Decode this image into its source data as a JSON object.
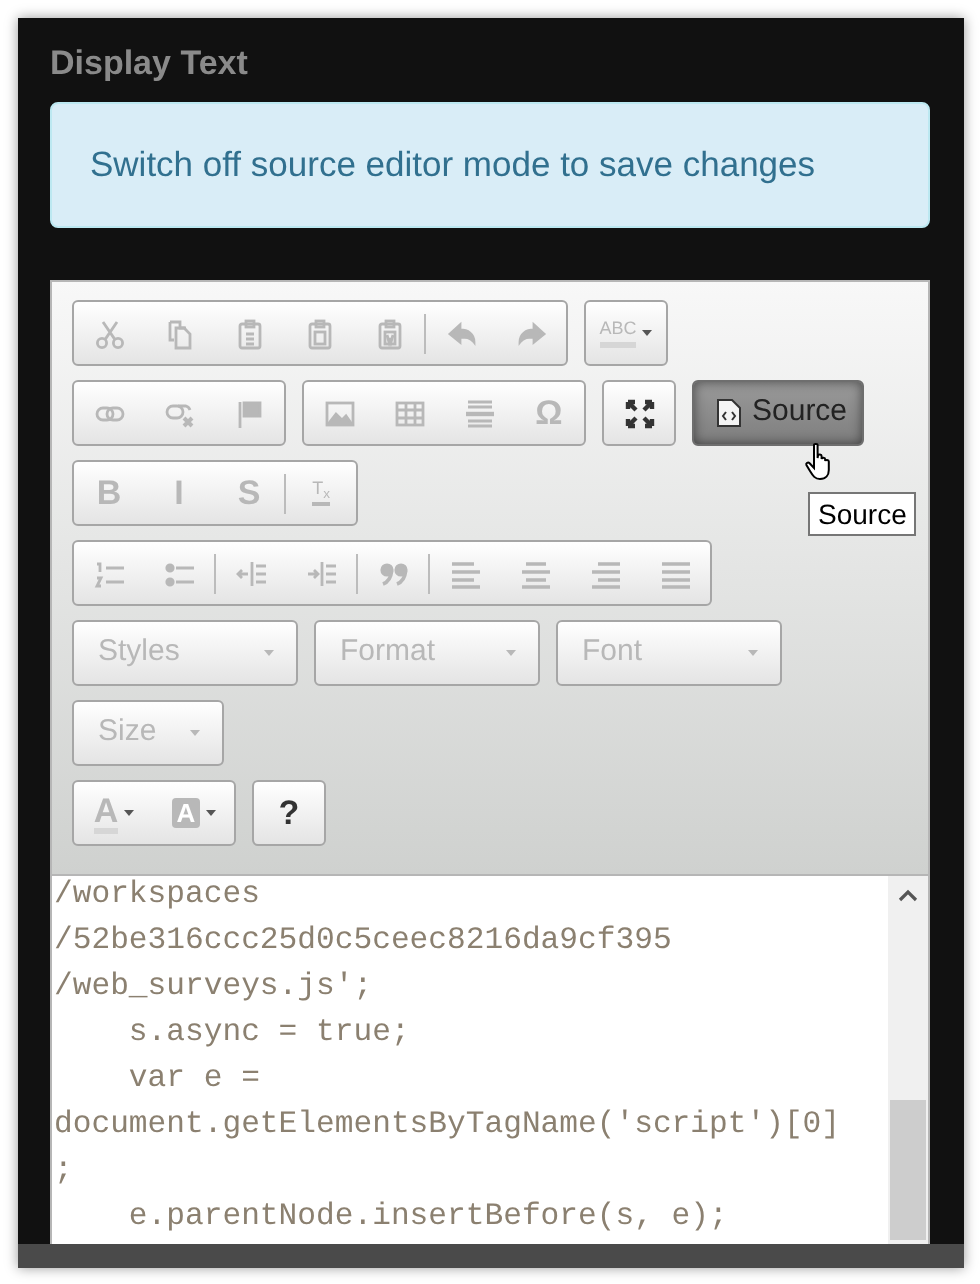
{
  "section_title": "Display Text",
  "notice": "Switch off source editor mode to save changes",
  "editor": {
    "toolbar_rows": [
      [
        {
          "sets": [
            [
              {
                "kind": "icon",
                "disabled": true
              },
              {
                "kind": "icon",
                "disabled": true
              },
              {
                "kind": "icon",
                "disabled": true
              },
              {
                "kind": "icon",
                "disabled": true
              },
              {
                "kind": "icon",
                "disabled": true
              }
            ],
            [
              {
                "kind": "icon",
                "disabled": true
              },
              {
                "kind": "icon",
                "disabled": true
              }
            ]
          ]
        },
        {
          "sets": [
            [
              {
                "kind": "glyph",
                "glyph": "ABC",
                "disabled": true,
                "menu": true
              }
            ]
          ]
        }
      ],
      [
        {
          "sets": [
            [
              {
                "kind": "icon",
                "disabled": true
              },
              {
                "kind": "icon",
                "disabled": true
              },
              {
                "kind": "icon",
                "disabled": true
              }
            ]
          ]
        },
        {
          "sets": [
            [
              {
                "kind": "icon",
                "disabled": true
              },
              {
                "kind": "icon",
                "disabled": true
              },
              {
                "kind": "icon",
                "disabled": true
              },
              {
                "kind": "glyph",
                "glyph": "Ω",
                "disabled": true
              }
            ]
          ]
        },
        {
          "sets": [
            [
              {
                "kind": "icon",
                "disabled": false
              }
            ]
          ]
        },
        {
          "sets": [
            [
              {
                "kind": "labeled",
                "label": "Source",
                "disabled": false,
                "pressed": true,
                "hovered": true,
                "tooltip": "Source"
              }
            ]
          ]
        }
      ],
      [
        {
          "sets": [
            [
              {
                "kind": "glyph",
                "glyph": "B",
                "disabled": true
              },
              {
                "kind": "glyph",
                "glyph": "I",
                "disabled": true
              },
              {
                "kind": "glyph",
                "glyph": "S",
                "disabled": true
              }
            ],
            [
              {
                "kind": "glyph",
                "glyph": "T$_{x}$",
                "disabled": true
              }
            ]
          ]
        }
      ],
      [
        {
          "sets": [
            [
              {
                "kind": "icon",
                "disabled": true
              },
              {
                "kind": "icon",
                "disabled": true
              }
            ],
            [
              {
                "kind": "icon",
                "disabled": true
              },
              {
                "kind": "icon",
                "disabled": true
              }
            ],
            [
              {
                "kind": "icon",
                "disabled": true
              }
            ],
            [
              {
                "kind": "icon",
                "disabled": true
              },
              {
                "kind": "icon",
                "disabled": true
              },
              {
                "kind": "icon",
                "disabled": true
              },
              {
                "kind": "icon",
                "disabled": true
              }
            ]
          ]
        }
      ],
      [
        {
          "kind": "combo",
          "label": "Styles",
          "disabled": true
        },
        {
          "kind": "combo",
          "label": "Format",
          "disabled": true
        },
        {
          "kind": "combo",
          "label": "Font",
          "disabled": true
        }
      ],
      [
        {
          "kind": "combo",
          "label": "Size",
          "disabled": true
        }
      ],
      [
        {
          "sets": [
            [
              {
                "kind": "glyph",
                "glyph": "A",
                "disabled": true,
                "menu": true
              },
              {
                "kind": "glyph",
                "glyph": "A",
                "disabled": true,
                "menu": true,
                "boxed": true
              }
            ]
          ]
        },
        {
          "sets": [
            [
              {
                "kind": "glyph",
                "glyph": "?",
                "disabled": false
              }
            ]
          ]
        }
      ]
    ],
    "source_lines": [
      "/workspaces",
      "/52be316ccc25d0c5ceec8216da9cf395",
      "/web_surveys.js';",
      "    s.async = true;",
      "    var e =",
      "document.getElementsByTagName('script')[0]",
      ";",
      "    e.parentNode.insertBefore(s, e);"
    ]
  }
}
